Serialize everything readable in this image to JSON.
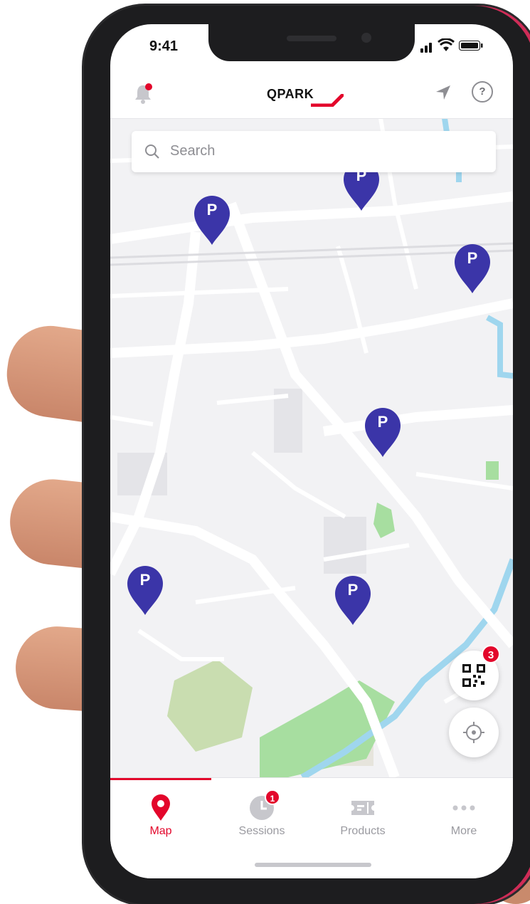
{
  "status_bar": {
    "time": "9:41"
  },
  "header": {
    "logo_text": "QPARK",
    "brand_color": "#e3062b"
  },
  "search": {
    "placeholder": "Search"
  },
  "map": {
    "pins": [
      {
        "label": "P"
      },
      {
        "label": "P"
      },
      {
        "label": "P"
      },
      {
        "label": "P"
      },
      {
        "label": "P"
      },
      {
        "label": "P"
      }
    ],
    "pin_color": "#3b35a8"
  },
  "fabs": {
    "qr_badge": "3"
  },
  "tabs": [
    {
      "label": "Map",
      "icon": "map-pin-icon",
      "active": true
    },
    {
      "label": "Sessions",
      "icon": "clock-icon",
      "badge": "1"
    },
    {
      "label": "Products",
      "icon": "ticket-icon"
    },
    {
      "label": "More",
      "icon": "more-dots-icon"
    }
  ]
}
